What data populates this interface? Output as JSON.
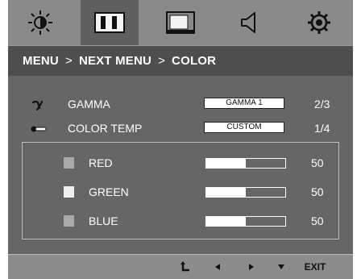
{
  "tabs": [
    {
      "name": "brightness-icon",
      "active": false
    },
    {
      "name": "picture-icon",
      "active": true
    },
    {
      "name": "screen-icon",
      "active": false
    },
    {
      "name": "sound-icon",
      "active": false
    },
    {
      "name": "settings-icon",
      "active": false
    }
  ],
  "breadcrumb": {
    "level1": "MENU",
    "sep1": ">",
    "level2": "NEXT MENU",
    "sep2": ">",
    "level3": "COLOR"
  },
  "settings": [
    {
      "icon": "gamma-icon",
      "label": "GAMMA",
      "value": "GAMMA 1",
      "position": "2/3"
    },
    {
      "icon": "thermometer-icon",
      "label": "COLOR TEMP",
      "value": "CUSTOM",
      "position": "1/4"
    }
  ],
  "channels": [
    {
      "label": "RED",
      "value": "50",
      "level": 0.5
    },
    {
      "label": "GREEN",
      "value": "50",
      "level": 0.5
    },
    {
      "label": "BLUE",
      "value": "50",
      "level": 0.5
    }
  ],
  "bottom": {
    "exit_label": "EXIT"
  },
  "colors": {
    "panel": "#6a6a6a",
    "tabbar": "#8a8a8a",
    "breadcrumb_bg": "#4e4e4e",
    "swatch_red": "#a9a9a9",
    "swatch_green": "#eeeeee",
    "swatch_blue": "#a9a9a9"
  }
}
